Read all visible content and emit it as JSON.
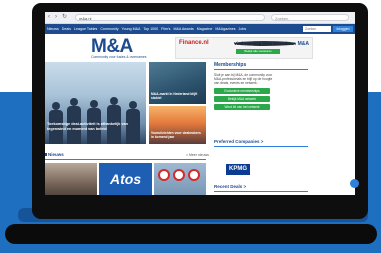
{
  "browser": {
    "url": "m&a.nl",
    "search_placeholder": "Zoeken"
  },
  "site_nav": {
    "items": [
      "Nieuws",
      "Deals",
      "League Tables",
      "Community",
      "Young M&A",
      "Top 1000",
      "Film's",
      "M&A Awards",
      "Magazine",
      "M&Agazines",
      "Jobs"
    ],
    "search_placeholder": "Zoeken",
    "member_label": "Inloggen"
  },
  "logo": {
    "mark": "M&A",
    "tagline": "Community voor fusies & overnames"
  },
  "banner": {
    "brand": "Finance.nl",
    "headline": "Vind vandaag jouw droombaan",
    "cta": "Bekijk alle vacatures",
    "badge": "M&A"
  },
  "hero": {
    "main_caption": "Toekomstige deal-activiteit is afhankelijk van tegenwind en moment van beleid",
    "top_right_caption": "M&A-markt in Nederland blijft stabiel",
    "bottom_right_caption": "Vooruitzichten voor dealmakers in komend jaar"
  },
  "sidebar": {
    "membership_title": "Memberships",
    "membership_text": "Sluit je aan bij M&A, de community voor M&A-professionals en blijf op de hoogte van deals, events en netwerk.",
    "buttons": [
      "Exclusieve memberships",
      "Bekijk M&A netwerk",
      "Word lid van het netwerk"
    ],
    "preferred_title": "Preferred Companies >",
    "preferred_logo": "KPMG",
    "recent_title": "Recent Deals >"
  },
  "news": {
    "label": "Nieuws",
    "more_label": "> Meer nieuws",
    "thumb_brand": "Atos"
  },
  "colors": {
    "brand_blue": "#1c4b8f",
    "accent_blue": "#2f80d8",
    "cta_green": "#2aa84a",
    "wall_blue": "#1f6fc0"
  }
}
